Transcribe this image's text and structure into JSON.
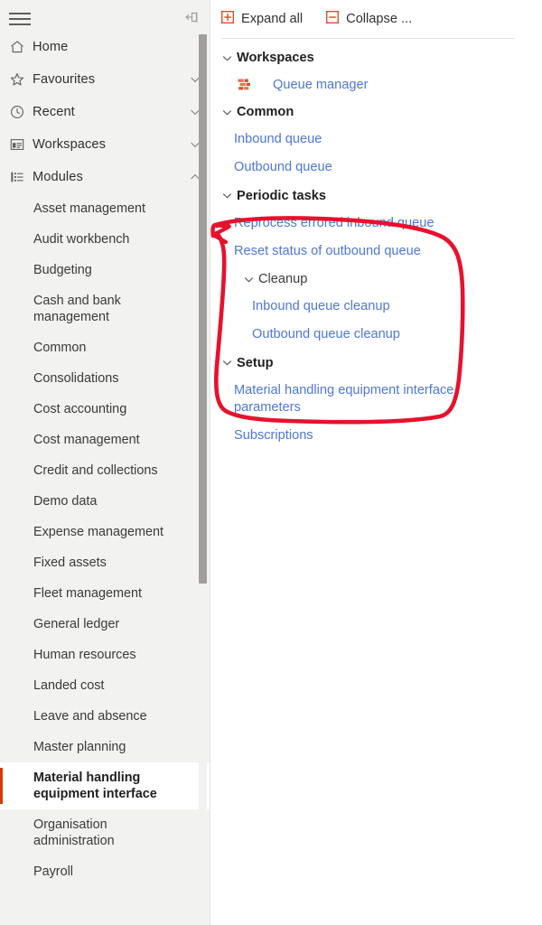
{
  "sidebar": {
    "menu_icon": "hamburger-icon",
    "pin_icon": "pin-left-icon",
    "nav": [
      {
        "label": "Home",
        "icon": "home-icon",
        "chevron": "none"
      },
      {
        "label": "Favourites",
        "icon": "star-icon",
        "chevron": "down"
      },
      {
        "label": "Recent",
        "icon": "clock-icon",
        "chevron": "down"
      },
      {
        "label": "Workspaces",
        "icon": "dashboard-icon",
        "chevron": "down"
      },
      {
        "label": "Modules",
        "icon": "list-icon",
        "chevron": "up"
      }
    ],
    "modules": [
      {
        "label": "Asset management",
        "selected": false
      },
      {
        "label": "Audit workbench",
        "selected": false
      },
      {
        "label": "Budgeting",
        "selected": false
      },
      {
        "label": "Cash and bank management",
        "selected": false
      },
      {
        "label": "Common",
        "selected": false
      },
      {
        "label": "Consolidations",
        "selected": false
      },
      {
        "label": "Cost accounting",
        "selected": false
      },
      {
        "label": "Cost management",
        "selected": false
      },
      {
        "label": "Credit and collections",
        "selected": false
      },
      {
        "label": "Demo data",
        "selected": false
      },
      {
        "label": "Expense management",
        "selected": false
      },
      {
        "label": "Fixed assets",
        "selected": false
      },
      {
        "label": "Fleet management",
        "selected": false
      },
      {
        "label": "General ledger",
        "selected": false
      },
      {
        "label": "Human resources",
        "selected": false
      },
      {
        "label": "Landed cost",
        "selected": false
      },
      {
        "label": "Leave and absence",
        "selected": false
      },
      {
        "label": "Master planning",
        "selected": false
      },
      {
        "label": "Material handling equipment interface",
        "selected": true
      },
      {
        "label": "Organisation administration",
        "selected": false
      },
      {
        "label": "Payroll",
        "selected": false
      }
    ],
    "selected_accent_color": "#d83b01",
    "background_color": "#f2f2f1"
  },
  "toolbar": {
    "expand_all_label": "Expand all",
    "expand_all_icon": "plus-square-icon",
    "collapse_label": "Collapse ...",
    "collapse_icon": "minus-square-icon",
    "icon_color": "#e04e2e"
  },
  "tree": {
    "link_color": "#4f76da",
    "workspaces": {
      "label": "Workspaces",
      "chevron": "down",
      "items": [
        {
          "label": "Queue manager",
          "icon": "workspace-tiles-icon"
        }
      ]
    },
    "common": {
      "label": "Common",
      "chevron": "down",
      "links": [
        "Inbound queue",
        "Outbound queue"
      ]
    },
    "periodic_tasks": {
      "label": "Periodic tasks",
      "chevron": "down",
      "links": [
        "Reprocess errored inbound queue",
        "Reset status of outbound queue"
      ],
      "cleanup": {
        "label": "Cleanup",
        "chevron": "down",
        "links": [
          "Inbound queue cleanup",
          "Outbound queue cleanup"
        ]
      }
    },
    "setup": {
      "label": "Setup",
      "chevron": "down",
      "links": [
        "Material handling equipment interface parameters",
        "Subscriptions"
      ]
    }
  },
  "annotation": {
    "type": "hand-drawn-lasso",
    "color": "#e8112d",
    "stroke_width": 4.5,
    "encircles": "Periodic tasks section including Cleanup subsection"
  }
}
